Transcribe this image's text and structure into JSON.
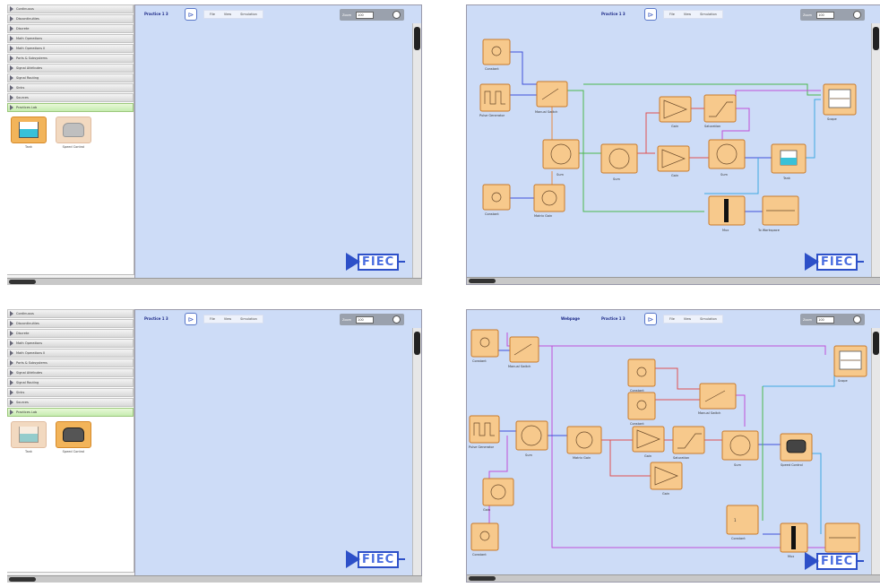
{
  "library": {
    "categories": [
      "Continuous",
      "Discontinuities",
      "Discrete",
      "Math Operations",
      "Math Operations II",
      "Ports & Subsystems",
      "Signal Attributes",
      "Signal Routing",
      "Sinks",
      "Sources",
      "Practices Lab"
    ],
    "blocks": [
      "Tank",
      "Speed Control"
    ],
    "footer": "Editor"
  },
  "panels": [
    {
      "title": "Practice 1 3",
      "zoom": "100"
    },
    {
      "title": "Practice 1 3",
      "zoom": "100"
    },
    {
      "title": "Practice 1 3",
      "zoom": "100"
    },
    {
      "title": "Practice 1 3",
      "crumb": "Webpage",
      "zoom": "100"
    }
  ],
  "toolbar": {
    "file": "File",
    "view": "View",
    "simulation": "Simulation",
    "zoom_label": "Zoom"
  },
  "logo": {
    "text": "FIEC"
  },
  "diagram_top": {
    "blocks": [
      "Constant",
      "Pulse Generator",
      "Manual Switch",
      "Sum",
      "Constant",
      "Matrix Gain",
      "Gain",
      "Gain",
      "Saturation",
      "Sum",
      "Tank",
      "Mux",
      "To Workspace",
      "Scope"
    ]
  },
  "diagram_bottom": {
    "blocks": [
      "Constant",
      "Manual Switch",
      "Pulse Generator",
      "Sum",
      "Gain",
      "Gain",
      "Saturation",
      "Sum",
      "Speed Control",
      "Constant",
      "Constant",
      "Manual Switch",
      "Gain",
      "Constant",
      "Mux",
      "To Workspace",
      "Scope",
      "Matrix Gain",
      "Constant"
    ]
  }
}
